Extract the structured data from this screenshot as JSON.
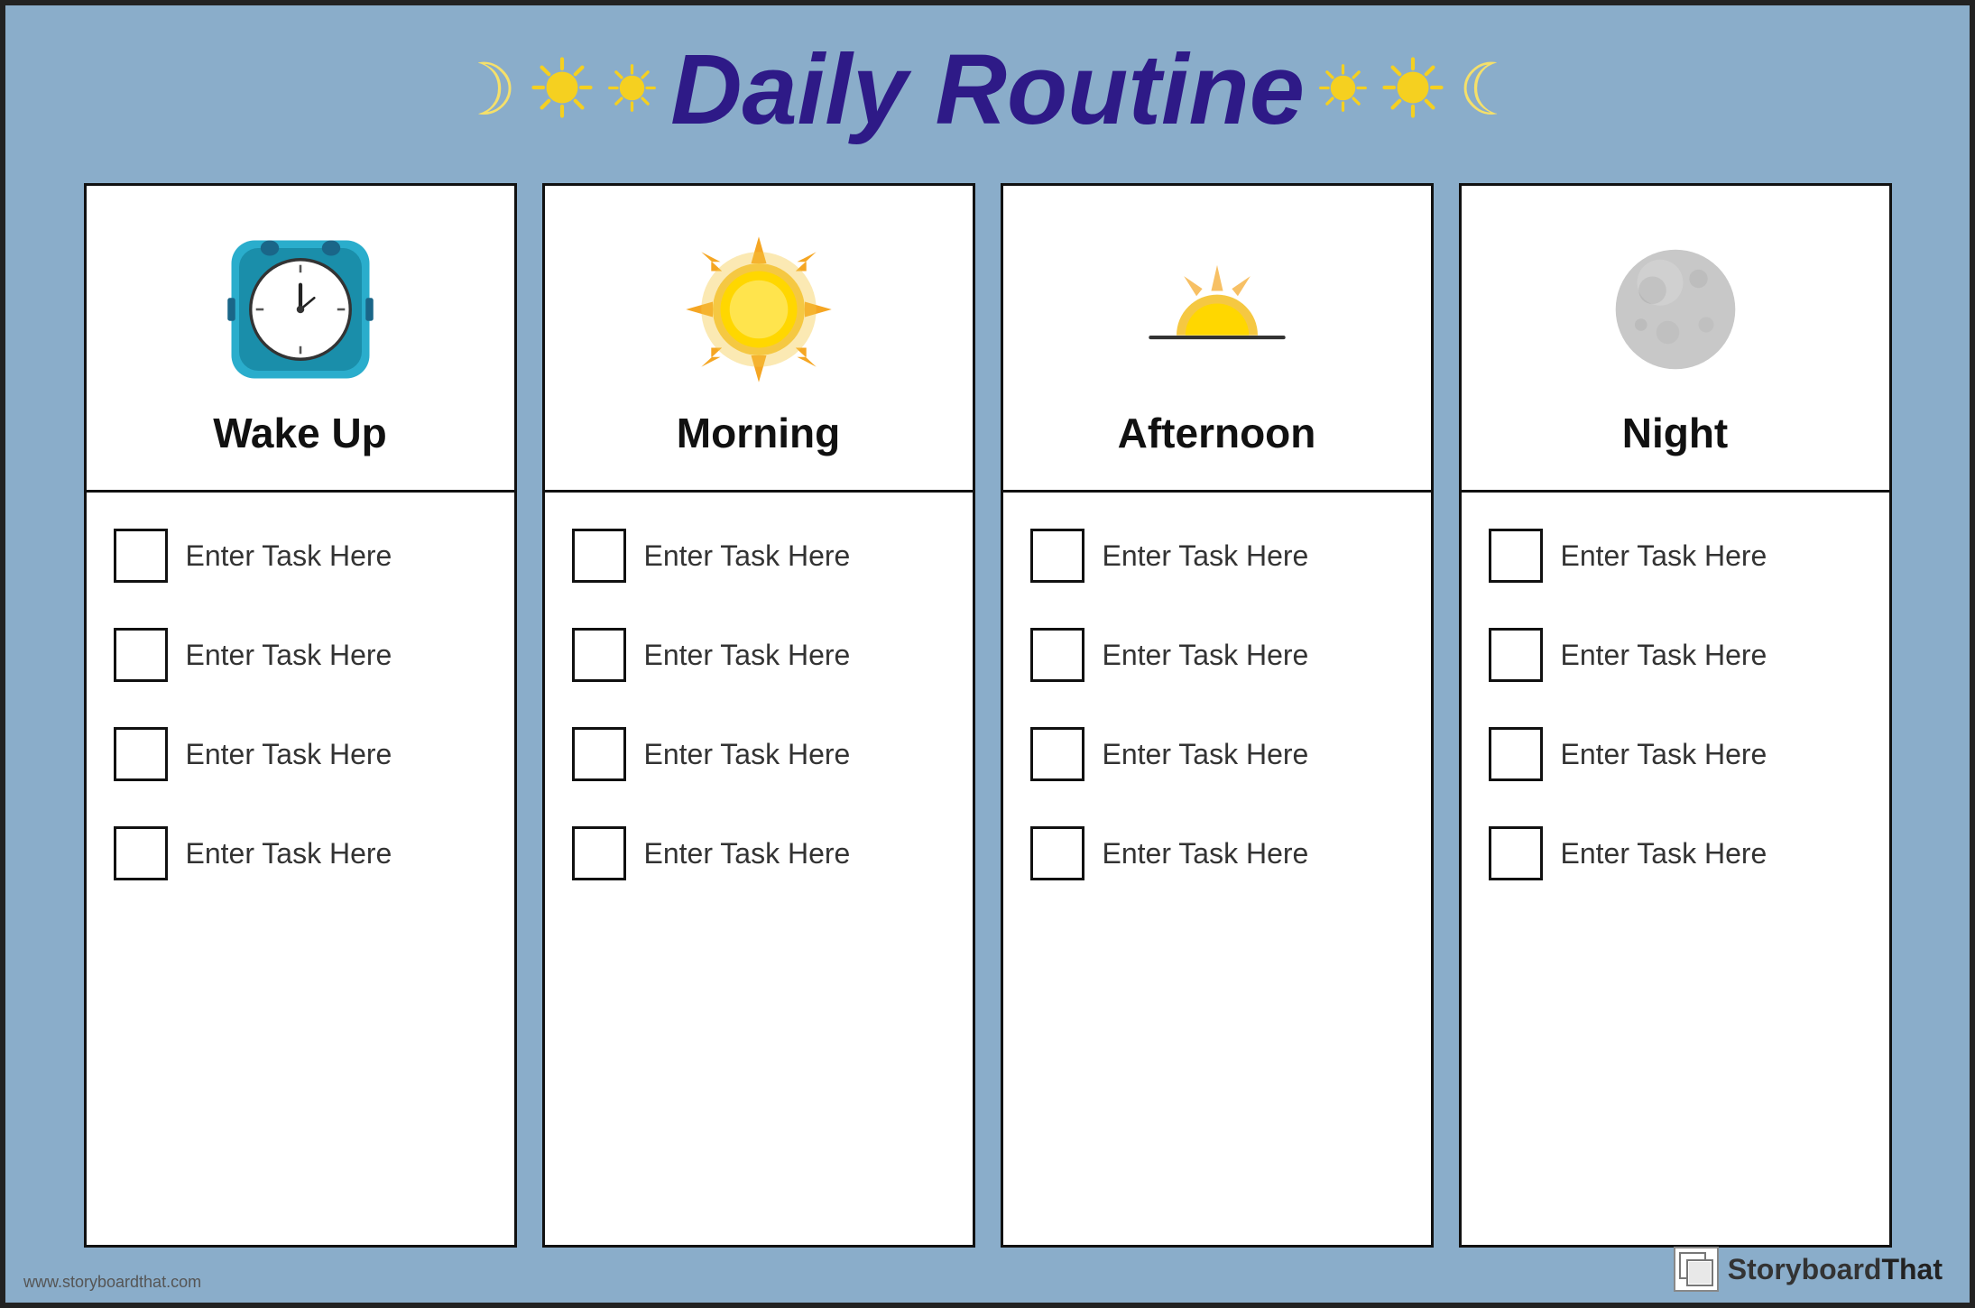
{
  "header": {
    "title": "Daily Routine",
    "decorators": {
      "left": [
        "moon",
        "sun",
        "sun"
      ],
      "right": [
        "sun",
        "sun",
        "moon"
      ]
    }
  },
  "columns": [
    {
      "id": "wake-up",
      "icon": "clock",
      "title": "Wake Up",
      "tasks": [
        "Enter Task Here",
        "Enter Task Here",
        "Enter Task Here",
        "Enter Task Here"
      ]
    },
    {
      "id": "morning",
      "icon": "sun",
      "title": "Morning",
      "tasks": [
        "Enter Task Here",
        "Enter Task Here",
        "Enter Task Here",
        "Enter Task Here"
      ]
    },
    {
      "id": "afternoon",
      "icon": "afternoon",
      "title": "Afternoon",
      "tasks": [
        "Enter Task Here",
        "Enter Task Here",
        "Enter Task Here",
        "Enter Task Here"
      ]
    },
    {
      "id": "night",
      "icon": "moon",
      "title": "Night",
      "tasks": [
        "Enter Task Here",
        "Enter Task Here",
        "Enter Task Here",
        "Enter Task Here"
      ]
    }
  ],
  "footer": {
    "website": "www.storyboardthat.com",
    "logo_text_normal": "Storyboard",
    "logo_text_bold": "That"
  }
}
